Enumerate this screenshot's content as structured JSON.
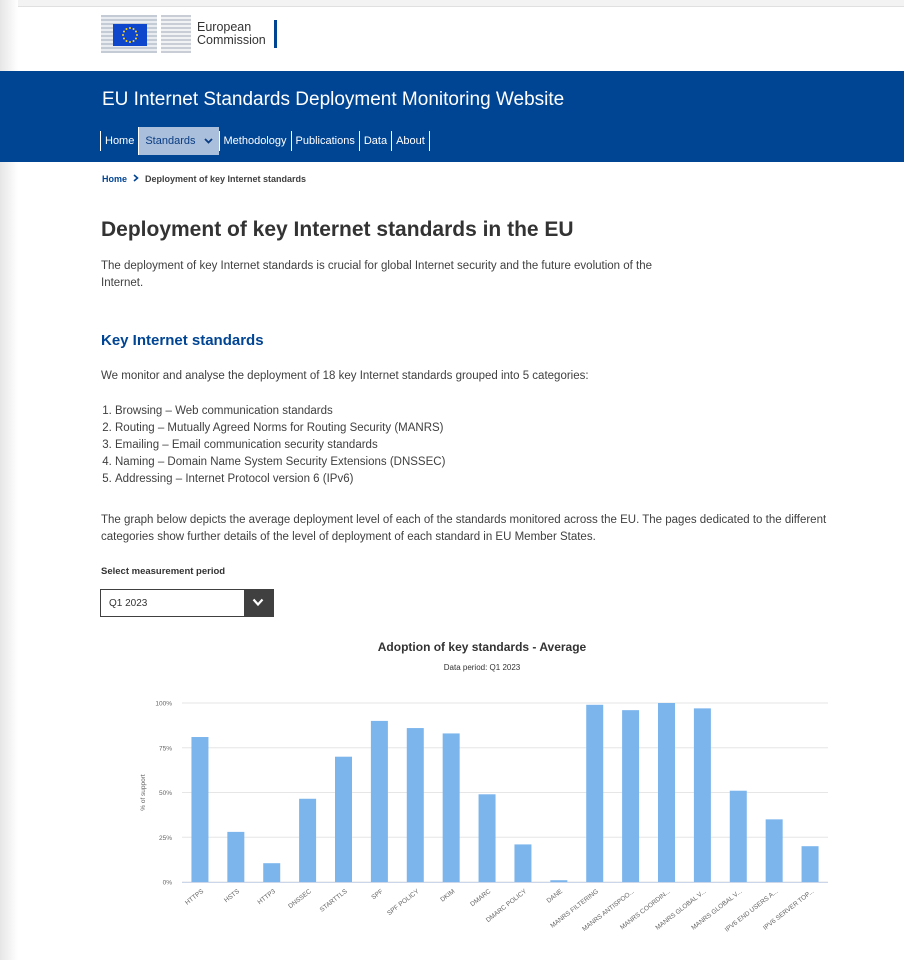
{
  "header": {
    "logo_line1": "European",
    "logo_line2": "Commission",
    "site_title": "EU Internet Standards Deployment Monitoring Website"
  },
  "nav": {
    "home": "Home",
    "standards": "Standards",
    "methodology": "Methodology",
    "publications": "Publications",
    "data": "Data",
    "about": "About"
  },
  "breadcrumb": {
    "home": "Home",
    "current": "Deployment of key Internet standards"
  },
  "main": {
    "title": "Deployment of key Internet standards in the EU",
    "intro": "The deployment of key Internet standards is crucial for global Internet security and the future evolution of the Internet.",
    "section_title": "Key Internet standards",
    "monitor_text": "We monitor and analyse the deployment of 18 key Internet standards grouped into 5 categories:",
    "categories": [
      "Browsing – Web communication standards",
      "Routing – Mutually Agreed Norms for Routing Security (MANRS)",
      "Emailing – Email communication security standards",
      "Naming – Domain Name System Security Extensions (DNSSEC)",
      "Addressing – Internet Protocol version 6 (IPv6)"
    ],
    "graph_desc": "The graph below depicts the average deployment level of each of the standards monitored across the EU. The pages dedicated to the different categories show further details of the level of deployment of each standard in EU Member States.",
    "select_label": "Select measurement period",
    "select_value": "Q1 2023"
  },
  "colors": {
    "brand_blue": "#004494",
    "bar": "#7cb5ec"
  },
  "chart_data": {
    "type": "bar",
    "title": "Adoption of key standards - Average",
    "subtitle": "Data period: Q1 2023",
    "ylabel": "% of support",
    "xlabel": "",
    "ylim": [
      0,
      100
    ],
    "yticks": [
      "0%",
      "25%",
      "50%",
      "75%",
      "100%"
    ],
    "grid": true,
    "categories": [
      "HTTPS",
      "HSTS",
      "HTTP3",
      "DNSSEC",
      "STARTTLS",
      "SPF",
      "SPF POLICY",
      "DKIM",
      "DMARC",
      "DMARC POLICY",
      "DANE",
      "MANRS FILTERING",
      "MANRS ANTISPOO...",
      "MANRS COORDIN...",
      "MANRS GLOBAL V...",
      "MANRS GLOBAL V...",
      "IPV6 END USERS A...",
      "IPV6 SERVER TOP..."
    ],
    "values": [
      81,
      28,
      10.5,
      46.5,
      70,
      90,
      86,
      83,
      49,
      21,
      1,
      99,
      96,
      100,
      97,
      51,
      35,
      20
    ]
  }
}
